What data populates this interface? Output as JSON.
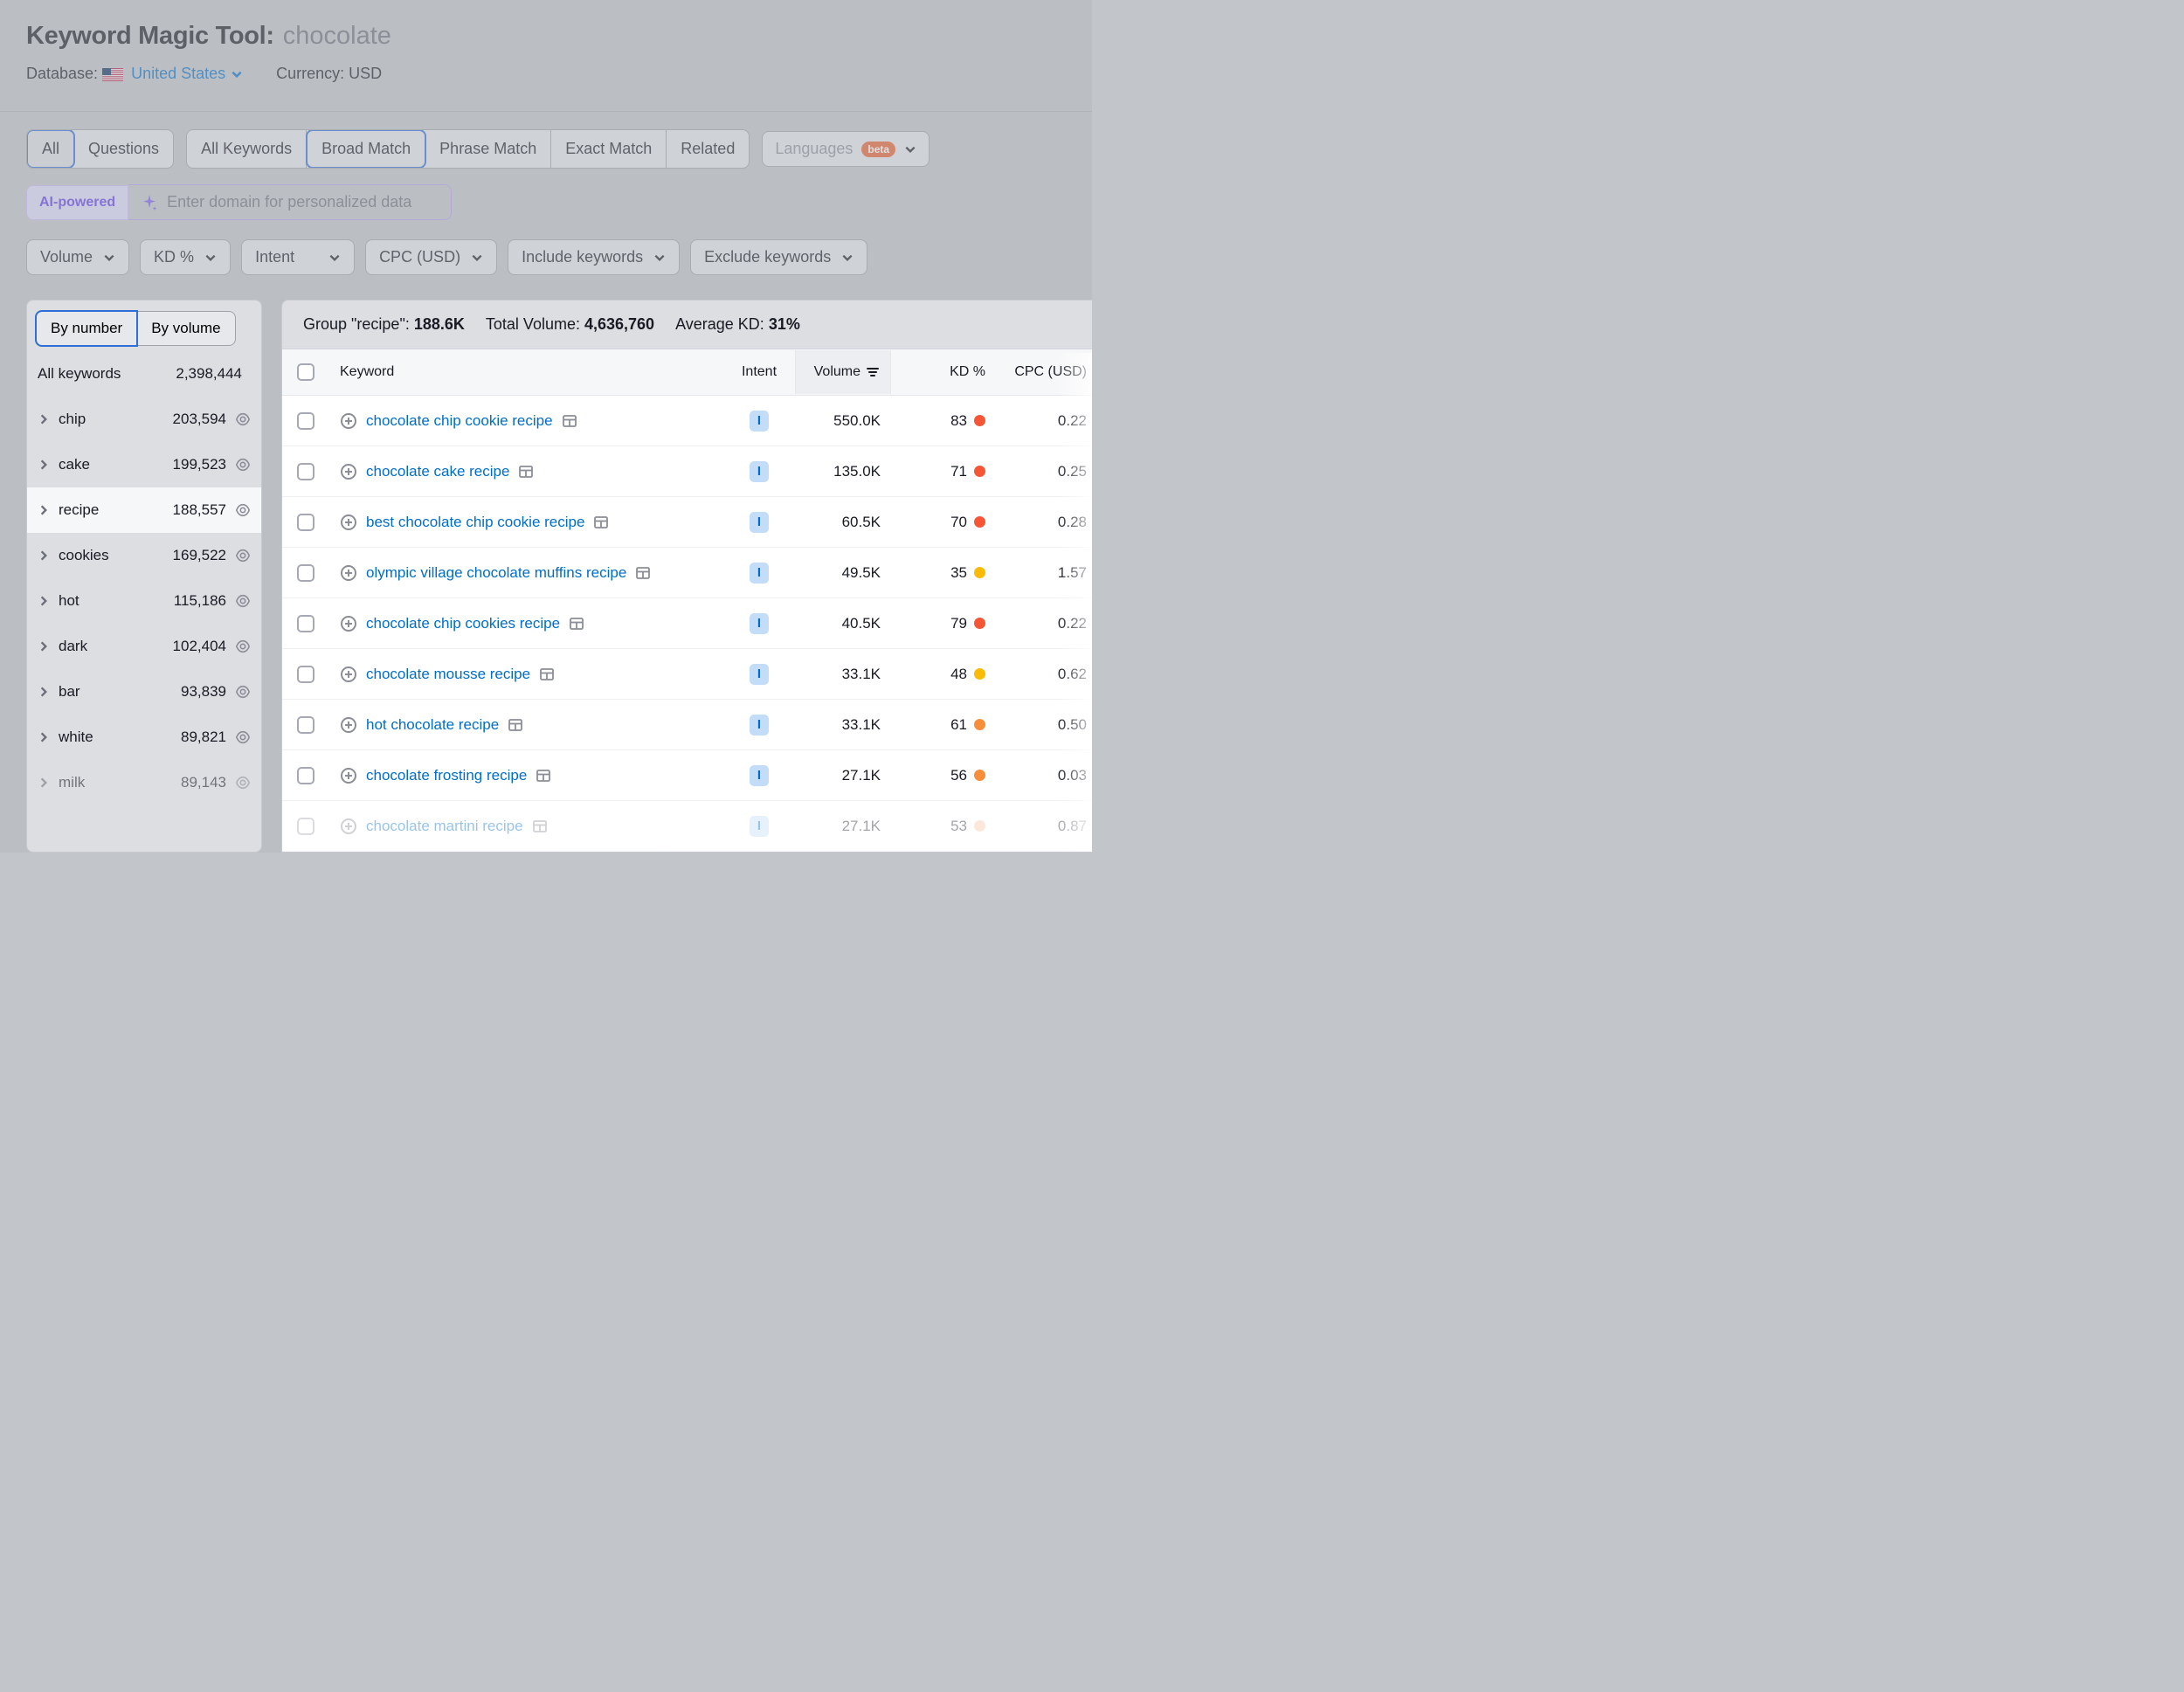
{
  "header": {
    "title": "Keyword Magic Tool:",
    "keyword": "chocolate",
    "database_label": "Database:",
    "database_value": "United States",
    "currency_label": "Currency: USD"
  },
  "tabs1": {
    "all": "All",
    "questions": "Questions"
  },
  "tabs2": {
    "all_keywords": "All Keywords",
    "broad": "Broad Match",
    "phrase": "Phrase Match",
    "exact": "Exact Match",
    "related": "Related"
  },
  "languages_label": "Languages",
  "beta": "beta",
  "ai": {
    "tag": "AI-powered",
    "placeholder": "Enter domain for personalized data"
  },
  "filters": {
    "volume": "Volume",
    "kd": "KD %",
    "intent": "Intent",
    "cpc": "CPC (USD)",
    "include": "Include keywords",
    "exclude": "Exclude keywords"
  },
  "sidebar": {
    "tab_number": "By number",
    "tab_volume": "By volume",
    "all_keywords": "All keywords",
    "all_count": "2,398,444",
    "items": [
      {
        "label": "chip",
        "count": "203,594",
        "active": false
      },
      {
        "label": "cake",
        "count": "199,523",
        "active": false
      },
      {
        "label": "recipe",
        "count": "188,557",
        "active": true
      },
      {
        "label": "cookies",
        "count": "169,522",
        "active": false
      },
      {
        "label": "hot",
        "count": "115,186",
        "active": false
      },
      {
        "label": "dark",
        "count": "102,404",
        "active": false
      },
      {
        "label": "bar",
        "count": "93,839",
        "active": false
      },
      {
        "label": "white",
        "count": "89,821",
        "active": false
      },
      {
        "label": "milk",
        "count": "89,143",
        "active": false
      }
    ]
  },
  "summary": {
    "group_label": "Group \"recipe\":",
    "group_value": "188.6K",
    "total_label": "Total Volume:",
    "total_value": "4,636,760",
    "avg_label": "Average KD:",
    "avg_value": "31%"
  },
  "table": {
    "headers": {
      "keyword": "Keyword",
      "intent": "Intent",
      "volume": "Volume",
      "kd": "KD %",
      "cpc": "CPC (USD)"
    },
    "rows": [
      {
        "keyword": "chocolate chip cookie recipe",
        "intent": "I",
        "volume": "550.0K",
        "kd": "83",
        "kd_color": "red",
        "cpc": "0.22"
      },
      {
        "keyword": "chocolate cake recipe",
        "intent": "I",
        "volume": "135.0K",
        "kd": "71",
        "kd_color": "red",
        "cpc": "0.25"
      },
      {
        "keyword": "best chocolate chip cookie recipe",
        "intent": "I",
        "volume": "60.5K",
        "kd": "70",
        "kd_color": "red",
        "cpc": "0.28"
      },
      {
        "keyword": "olympic village chocolate muffins recipe",
        "intent": "I",
        "volume": "49.5K",
        "kd": "35",
        "kd_color": "yellow",
        "cpc": "1.57"
      },
      {
        "keyword": "chocolate chip cookies recipe",
        "intent": "I",
        "volume": "40.5K",
        "kd": "79",
        "kd_color": "red",
        "cpc": "0.22"
      },
      {
        "keyword": "chocolate mousse recipe",
        "intent": "I",
        "volume": "33.1K",
        "kd": "48",
        "kd_color": "yellow",
        "cpc": "0.62"
      },
      {
        "keyword": "hot chocolate recipe",
        "intent": "I",
        "volume": "33.1K",
        "kd": "61",
        "kd_color": "orange",
        "cpc": "0.50"
      },
      {
        "keyword": "chocolate frosting recipe",
        "intent": "I",
        "volume": "27.1K",
        "kd": "56",
        "kd_color": "orange",
        "cpc": "0.03"
      },
      {
        "keyword": "chocolate martini recipe",
        "intent": "I",
        "volume": "27.1K",
        "kd": "53",
        "kd_color": "peach",
        "cpc": "0.87",
        "faded": true
      }
    ]
  }
}
